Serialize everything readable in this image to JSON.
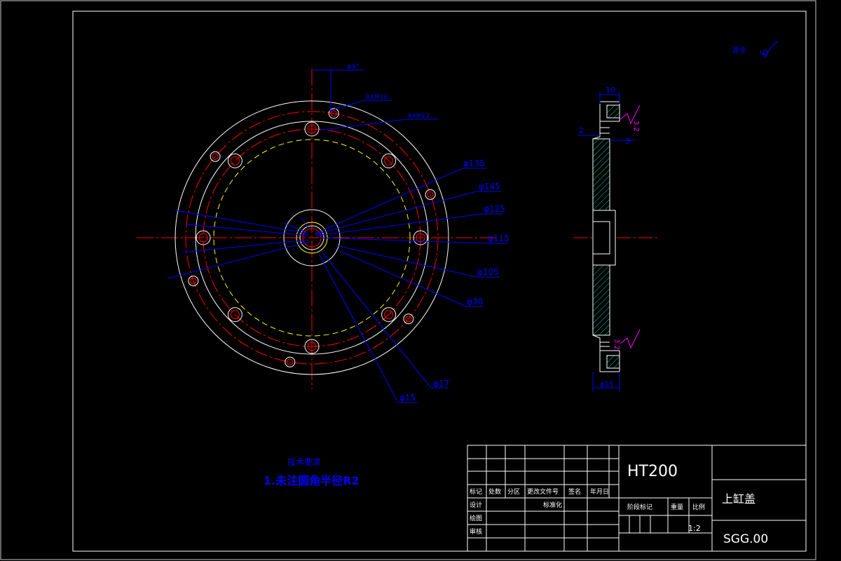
{
  "colors": {
    "background": "#000000",
    "frame": "#ffffff",
    "border": "#c8c8c8",
    "dimension": "#0000ff",
    "centerline": "#ff0000",
    "hidden": "#ffff00",
    "accent": "#ff00ff"
  },
  "front_view": {
    "dimensions": {
      "d_small": "φ9°",
      "thread_a": "6XM10",
      "thread_b": "6XM12",
      "d135": "φ135",
      "d145": "φ145",
      "d125": "φ125",
      "d115": "φ115",
      "d105": "φ105",
      "d30": "φ30",
      "d17": "φ17",
      "d15": "φ15"
    }
  },
  "side_view": {
    "dimensions": {
      "top_width": "10",
      "step_left": "2",
      "step_right": "3",
      "bottom_width": "φ15"
    },
    "roughness_top": "3.2",
    "roughness_bottom": "3.2"
  },
  "surface_finish_note": "其余",
  "tech_requirements": {
    "heading": "技术要求",
    "item1": "1.未注圆角半径R2"
  },
  "title_block": {
    "material": "HT200",
    "part_name": "上缸盖",
    "drawing_number": "SGG.00",
    "scale": "1:2",
    "headers": {
      "mark": "标记",
      "count": "处数",
      "zone": "分区",
      "change_doc": "更改文件号",
      "signature": "签名",
      "date": "年月日",
      "design": "设计",
      "standardize": "标准化",
      "drawing": "绘图",
      "review": "审核",
      "stage_mark": "阶段标记",
      "weight": "重量",
      "scale_label": "比例"
    }
  }
}
